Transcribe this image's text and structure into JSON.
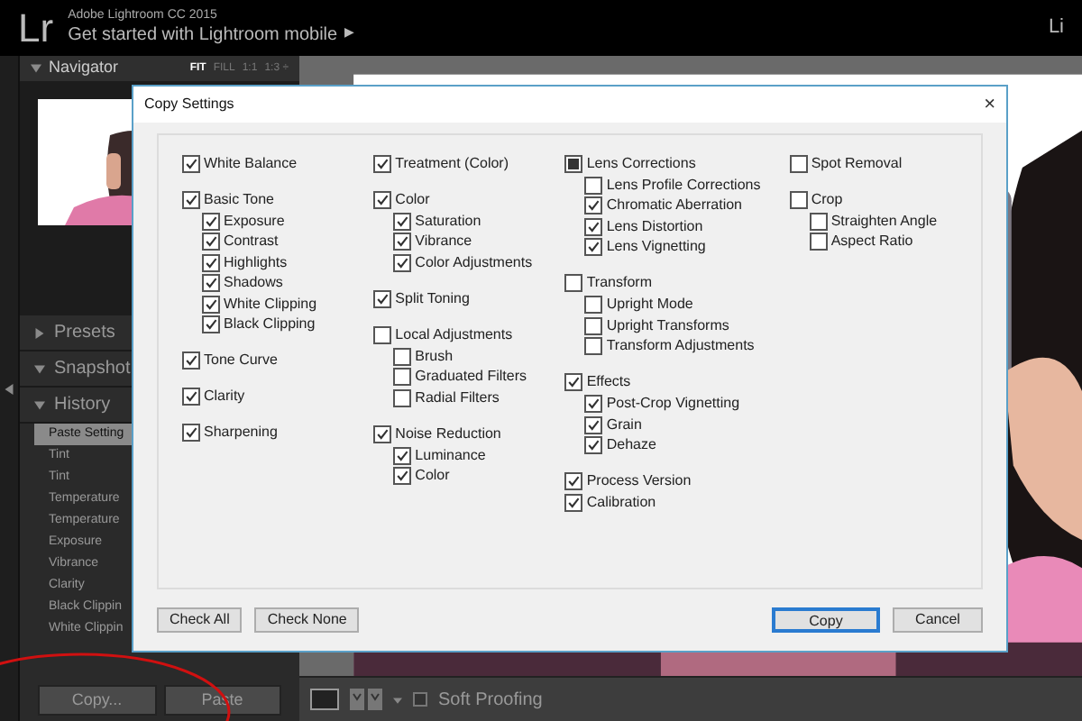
{
  "app_bar": {
    "logo": "Lr",
    "product": "Adobe Lightroom CC 2015",
    "promo": "Get started with Lightroom mobile",
    "promo_arrow": "▶",
    "module": "Li"
  },
  "left_panel": {
    "navigator": {
      "title": "Navigator",
      "expanded": true,
      "zoom_options": [
        {
          "label": "FIT",
          "selected": true
        },
        {
          "label": "FILL",
          "selected": false
        },
        {
          "label": "1:1",
          "selected": false
        },
        {
          "label": "1:3 ÷",
          "selected": false
        }
      ]
    },
    "sections": [
      {
        "title": "Presets",
        "expanded": false
      },
      {
        "title": "Snapshot",
        "expanded": true
      },
      {
        "title": "History",
        "expanded": true
      }
    ],
    "history": [
      {
        "label": "Paste Setting",
        "selected": true
      },
      {
        "label": "Tint",
        "selected": false
      },
      {
        "label": "Tint",
        "selected": false
      },
      {
        "label": "Temperature",
        "selected": false
      },
      {
        "label": "Temperature",
        "selected": false
      },
      {
        "label": "Exposure",
        "selected": false
      },
      {
        "label": "Vibrance",
        "selected": false
      },
      {
        "label": "Clarity",
        "selected": false
      },
      {
        "label": "Black Clippin",
        "selected": false
      },
      {
        "label": "White Clippin",
        "selected": false
      }
    ],
    "buttons": [
      "Copy...",
      "Paste"
    ]
  },
  "toolbar": {
    "soft_proofing": {
      "label": "Soft Proofing",
      "checked": false
    }
  },
  "dialog": {
    "title": "Copy Settings",
    "close": "×",
    "columns": [
      [
        [
          {
            "label": "White Balance",
            "checked": true
          }
        ],
        [
          {
            "label": "Basic Tone",
            "checked": true,
            "children": [
              {
                "label": "Exposure",
                "checked": true
              },
              {
                "label": "Contrast",
                "checked": true
              },
              {
                "label": "Highlights",
                "checked": true
              },
              {
                "label": "Shadows",
                "checked": true
              },
              {
                "label": "White Clipping",
                "checked": true
              },
              {
                "label": "Black Clipping",
                "checked": true
              }
            ]
          }
        ],
        [
          {
            "label": "Tone Curve",
            "checked": true
          }
        ],
        [
          {
            "label": "Clarity",
            "checked": true
          }
        ],
        [
          {
            "label": "Sharpening",
            "checked": true
          }
        ]
      ],
      [
        [
          {
            "label": "Treatment (Color)",
            "checked": true
          }
        ],
        [
          {
            "label": "Color",
            "checked": true,
            "children": [
              {
                "label": "Saturation",
                "checked": true
              },
              {
                "label": "Vibrance",
                "checked": true
              },
              {
                "label": "Color Adjustments",
                "checked": true
              }
            ]
          }
        ],
        [
          {
            "label": "Split Toning",
            "checked": true
          }
        ],
        [
          {
            "label": "Local Adjustments",
            "checked": false,
            "children": [
              {
                "label": "Brush",
                "checked": false
              },
              {
                "label": "Graduated Filters",
                "checked": false
              },
              {
                "label": "Radial Filters",
                "checked": false
              }
            ]
          }
        ],
        [
          {
            "label": "Noise Reduction",
            "checked": true,
            "children": [
              {
                "label": "Luminance",
                "checked": true
              },
              {
                "label": "Color",
                "checked": true
              }
            ]
          }
        ]
      ],
      [
        [
          {
            "label": "Lens Corrections",
            "checked": false,
            "partial": true,
            "children": [
              {
                "label": "Lens Profile Corrections",
                "checked": false
              },
              {
                "label": "Chromatic Aberration",
                "checked": true
              },
              {
                "label": "Lens Distortion",
                "checked": true
              },
              {
                "label": "Lens Vignetting",
                "checked": true
              }
            ]
          }
        ],
        [
          {
            "label": "Transform",
            "checked": false,
            "children": [
              {
                "label": "Upright Mode",
                "checked": false
              },
              {
                "label": "Upright Transforms",
                "checked": false
              },
              {
                "label": "Transform Adjustments",
                "checked": false
              }
            ]
          }
        ],
        [
          {
            "label": "Effects",
            "checked": true,
            "children": [
              {
                "label": "Post-Crop Vignetting",
                "checked": true
              },
              {
                "label": "Grain",
                "checked": true
              },
              {
                "label": "Dehaze",
                "checked": true
              }
            ]
          }
        ],
        [
          {
            "label": "Process Version",
            "checked": true
          },
          {
            "label": "Calibration",
            "checked": true
          }
        ]
      ],
      [
        [
          {
            "label": "Spot Removal",
            "checked": false
          }
        ],
        [
          {
            "label": "Crop",
            "checked": false,
            "children": [
              {
                "label": "Straighten Angle",
                "checked": false
              },
              {
                "label": "Aspect Ratio",
                "checked": false
              }
            ]
          }
        ]
      ]
    ],
    "buttons": [
      {
        "label": "Check All",
        "default": false
      },
      {
        "label": "Check None",
        "default": false
      },
      {
        "label": "Copy",
        "default": true
      },
      {
        "label": "Cancel",
        "default": false
      }
    ]
  }
}
